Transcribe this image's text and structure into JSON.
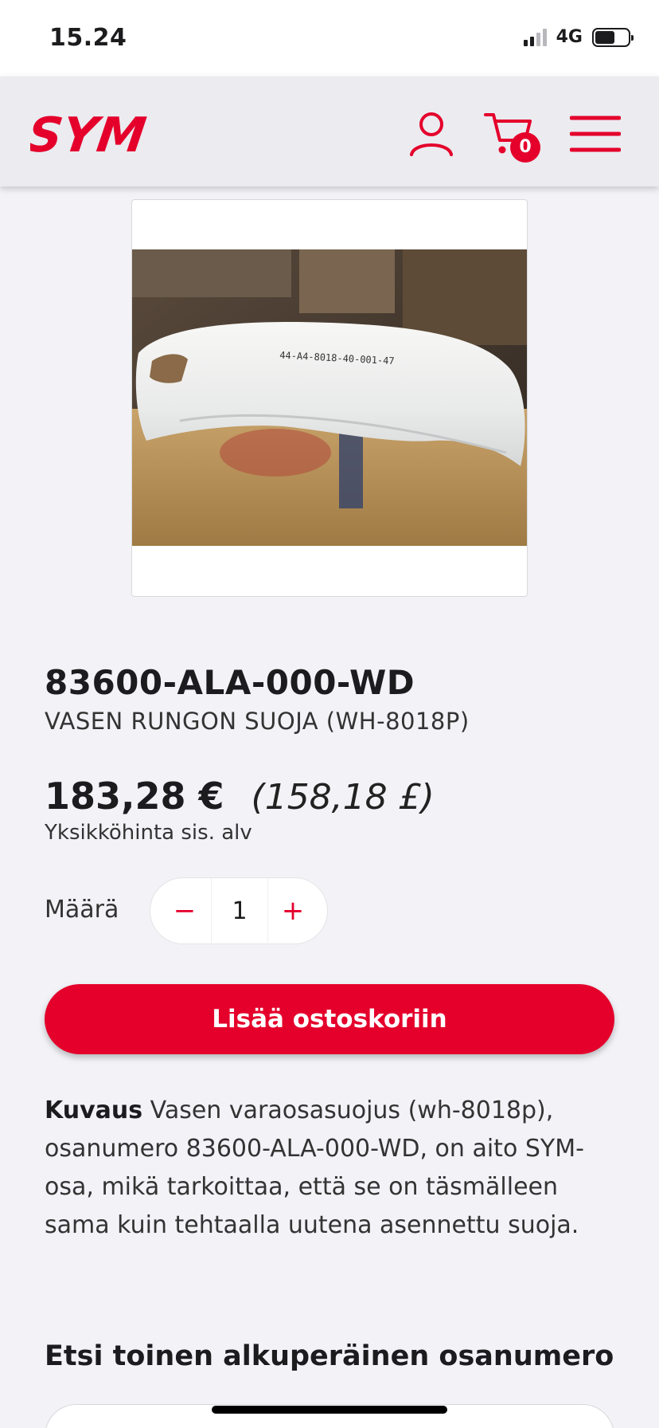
{
  "status_bar": {
    "time": "15.24",
    "network": "4G",
    "icons": [
      "signal-icon",
      "battery-icon"
    ]
  },
  "header": {
    "logo_text": "SYM",
    "icons": [
      "user-icon",
      "cart-icon",
      "menu-icon"
    ],
    "cart_count": "0"
  },
  "product": {
    "code": "83600-ALA-000-WD",
    "name": "VASEN RUNGON SUOJA (WH-8018P)",
    "image_label": "44-A4-8018-40-001-47",
    "price": "183,28 €",
    "price_alt": "(158,18 £)",
    "price_note": "Yksikköhinta sis. alv",
    "quantity_label": "Määrä",
    "quantity": "1",
    "minus": "−",
    "plus": "+",
    "add_to_cart": "Lisää ostoskoriin",
    "description_label": "Kuvaus",
    "description_text": "Vasen varaosasuojus (wh-8018p), osanumero 83600-ALA-000-WD, on aito SYM-osa, mikä tarkoittaa, että se on täsmälleen sama kuin tehtaalla uutena asennettu suoja."
  },
  "search_section": {
    "title": "Etsi toinen alkuperäinen osanumero"
  },
  "colors": {
    "brand": "#e4002b",
    "background": "#f2f2f7",
    "header": "#ebebf0"
  }
}
